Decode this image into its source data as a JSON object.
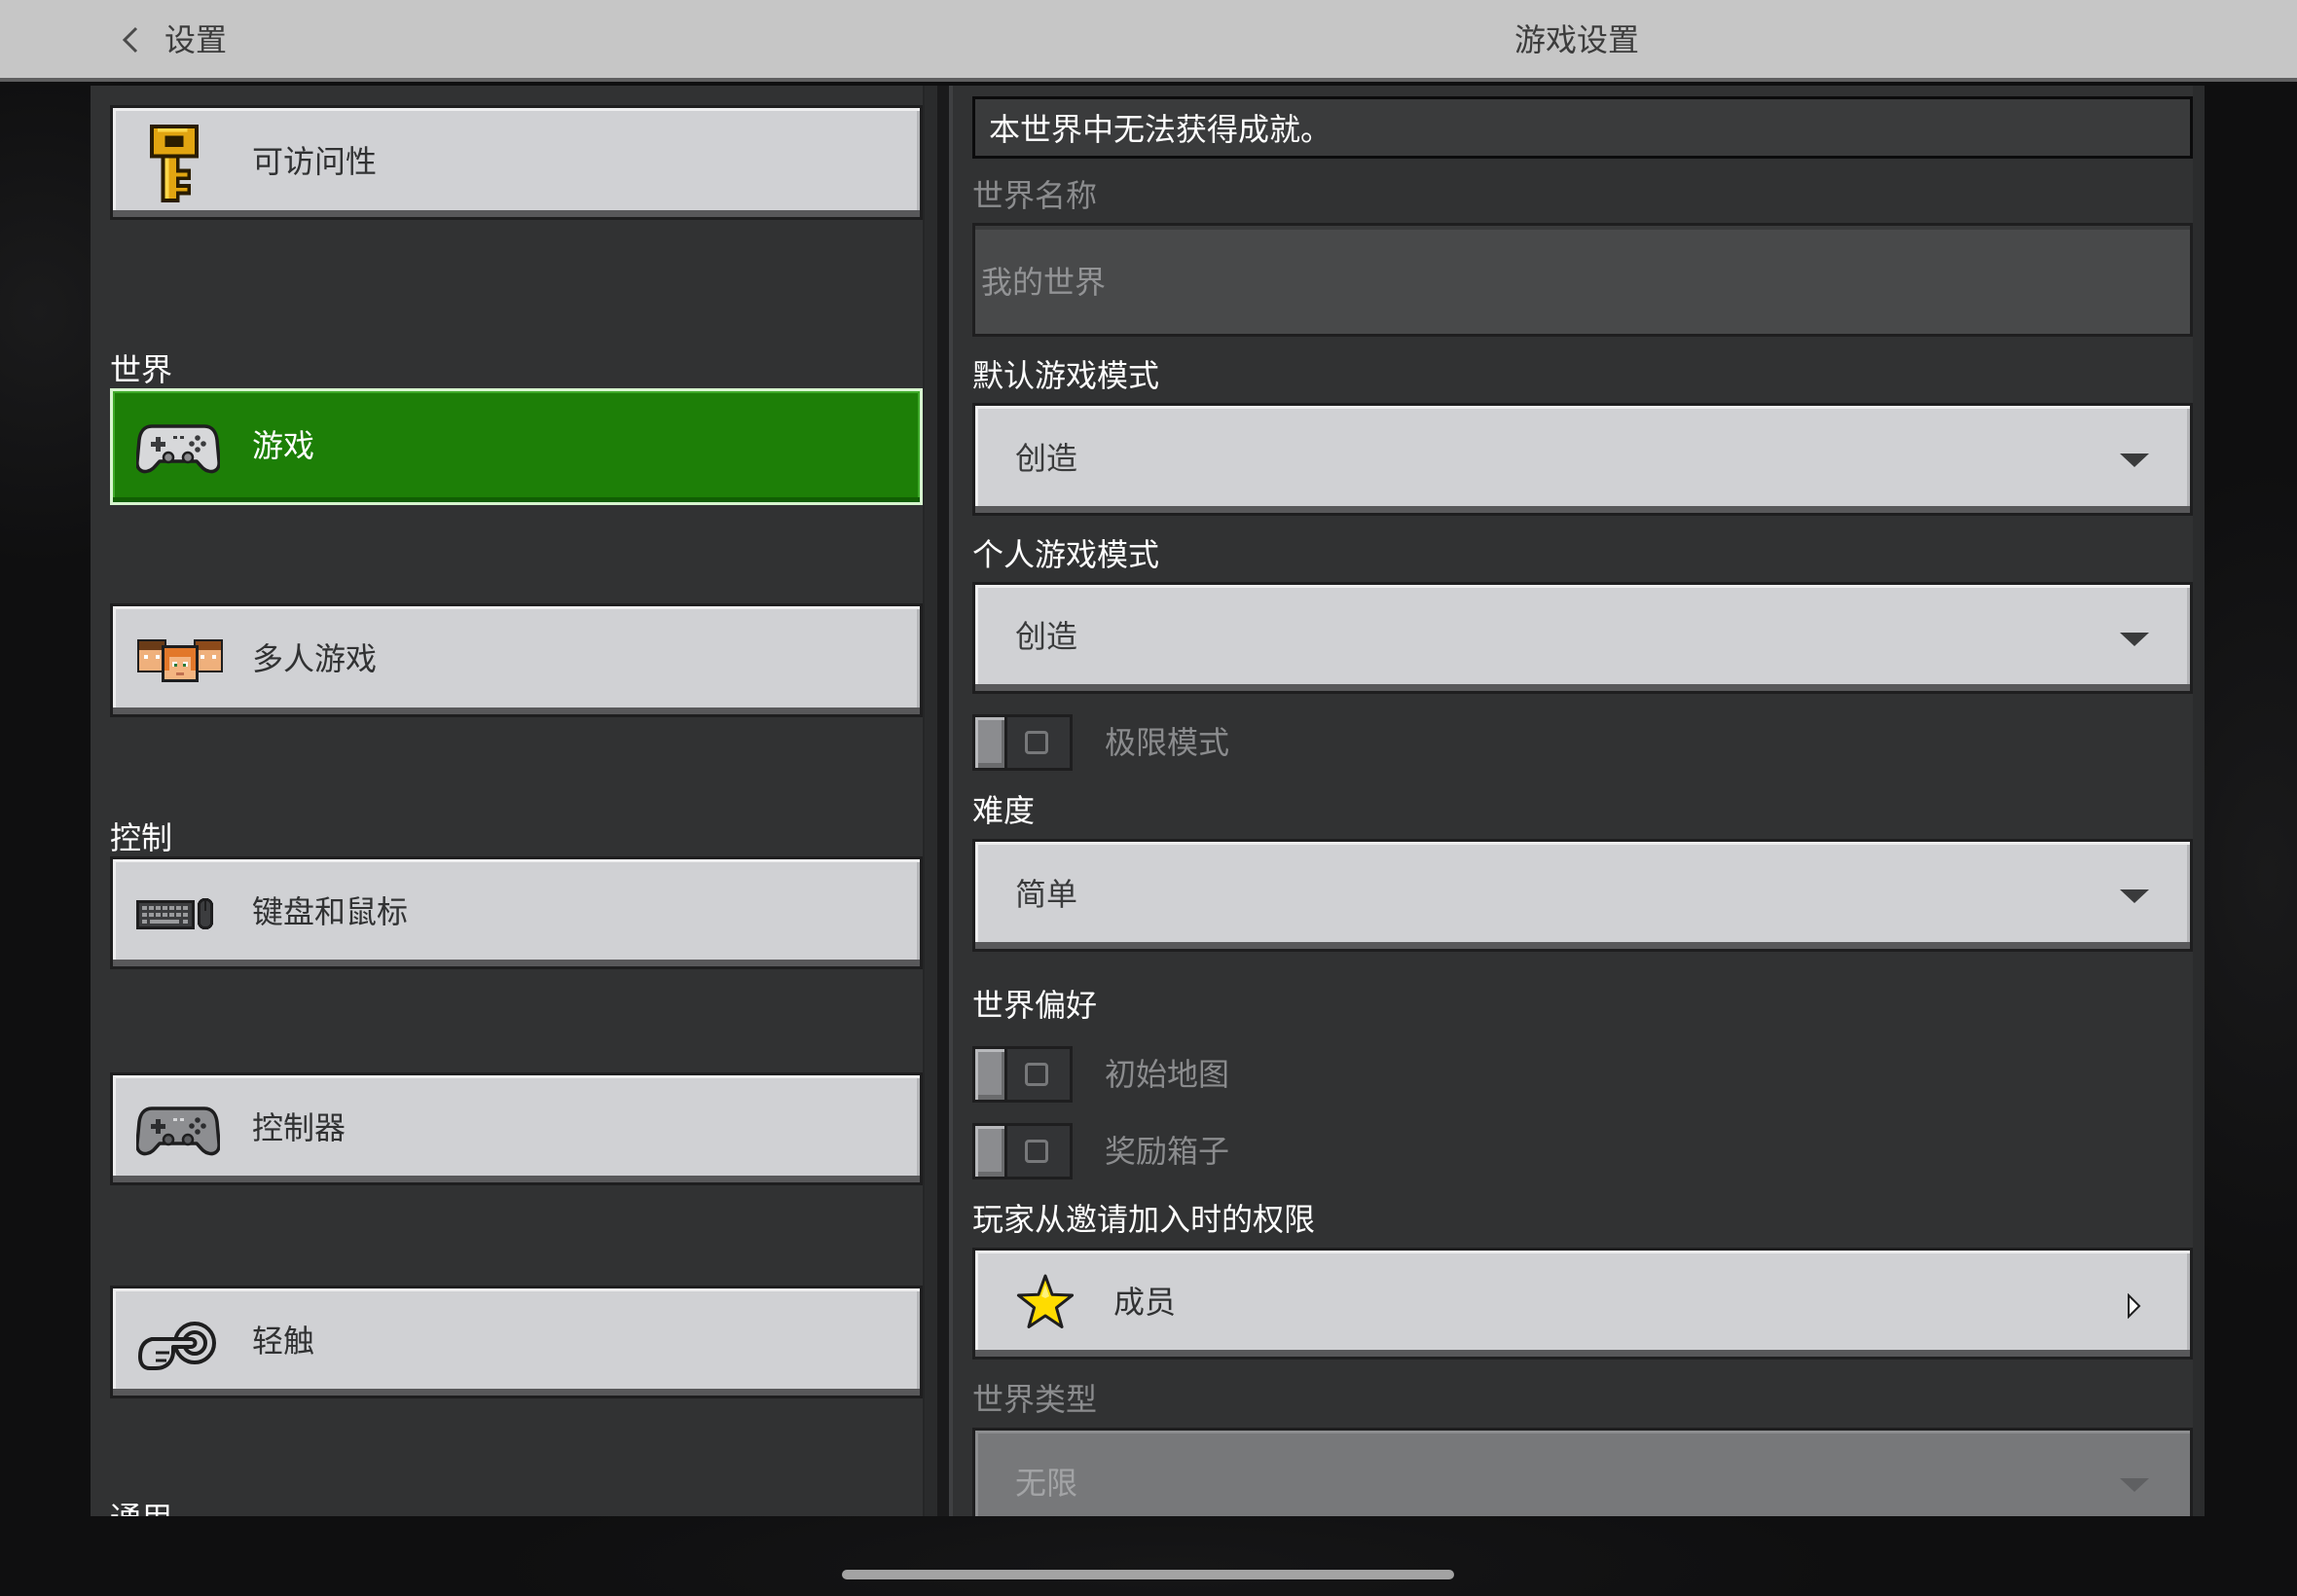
{
  "header": {
    "back_label": "设置",
    "back_icon": "chevron-left-icon",
    "title": "游戏设置"
  },
  "sidebar": {
    "top_items": [
      {
        "label": "可访问性",
        "icon": "key-icon"
      }
    ],
    "sections": [
      {
        "title": "世界",
        "items": [
          {
            "label": "游戏",
            "icon": "gamepad-icon",
            "selected": true
          },
          {
            "label": "多人游戏",
            "icon": "multiplayer-icon"
          }
        ]
      },
      {
        "title": "控制",
        "items": [
          {
            "label": "键盘和鼠标",
            "icon": "keyboard-mouse-icon"
          },
          {
            "label": "控制器",
            "icon": "controller-icon"
          },
          {
            "label": "轻触",
            "icon": "touch-icon"
          }
        ]
      },
      {
        "title": "通用",
        "items": []
      }
    ]
  },
  "main": {
    "notice": "本世界中无法获得成就。",
    "world_name": {
      "label": "世界名称",
      "value": "我的世界"
    },
    "default_game_mode": {
      "label": "默认游戏模式",
      "value": "创造"
    },
    "personal_game_mode": {
      "label": "个人游戏模式",
      "value": "创造"
    },
    "hardcore": {
      "label": "极限模式",
      "on": false
    },
    "difficulty": {
      "label": "难度",
      "value": "简单"
    },
    "world_preferences": {
      "heading": "世界偏好",
      "starting_map": {
        "label": "初始地图",
        "on": false
      },
      "bonus_chest": {
        "label": "奖励箱子",
        "on": false
      }
    },
    "invite_permission": {
      "label": "玩家从邀请加入时的权限",
      "value": "成员",
      "icon": "star-icon"
    },
    "world_type": {
      "label": "世界类型",
      "value": "无限",
      "disabled": true
    }
  },
  "colors": {
    "header_bg": "#c6c6c6",
    "panel_bg": "#313233",
    "button_bg": "#d0d1d4",
    "selected_green": "#1d7f07",
    "star_yellow": "#ffdc00",
    "key_gold": "#e2a511"
  }
}
